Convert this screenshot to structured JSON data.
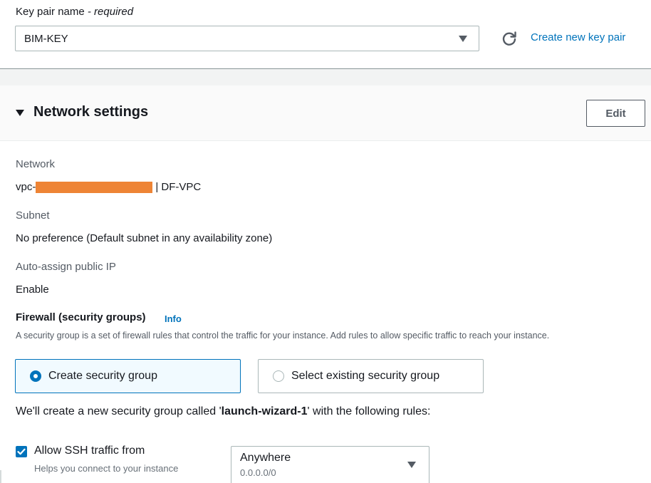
{
  "key_pair": {
    "label": "Key pair name",
    "required_suffix": "- required",
    "selected": "BIM-KEY",
    "create_link": "Create new key pair"
  },
  "network_settings": {
    "title": "Network settings",
    "edit_label": "Edit",
    "network_label": "Network",
    "vpc_prefix": "vpc-",
    "vpc_suffix": "| DF-VPC",
    "subnet_label": "Subnet",
    "subnet_value": "No preference (Default subnet in any availability zone)",
    "auto_ip_label": "Auto-assign public IP",
    "auto_ip_value": "Enable"
  },
  "firewall": {
    "title": "Firewall (security groups)",
    "info": "Info",
    "description": "A security group is a set of firewall rules that control the traffic for your instance. Add rules to allow specific traffic to reach your instance.",
    "options": [
      {
        "label": "Create security group",
        "selected": true
      },
      {
        "label": "Select existing security group",
        "selected": false
      }
    ],
    "note_prefix": "We'll create a new security group called '",
    "group_name": "launch-wizard-1",
    "note_suffix": "' with the following rules:"
  },
  "ssh_rule": {
    "label": "Allow SSH traffic from",
    "sublabel": "Helps you connect to your instance",
    "checked": true,
    "source_main": "Anywhere",
    "source_sub": "0.0.0.0/0"
  },
  "colors": {
    "link": "#0073bb",
    "redaction": "#ee8435",
    "selected_bg": "#f1faff"
  }
}
